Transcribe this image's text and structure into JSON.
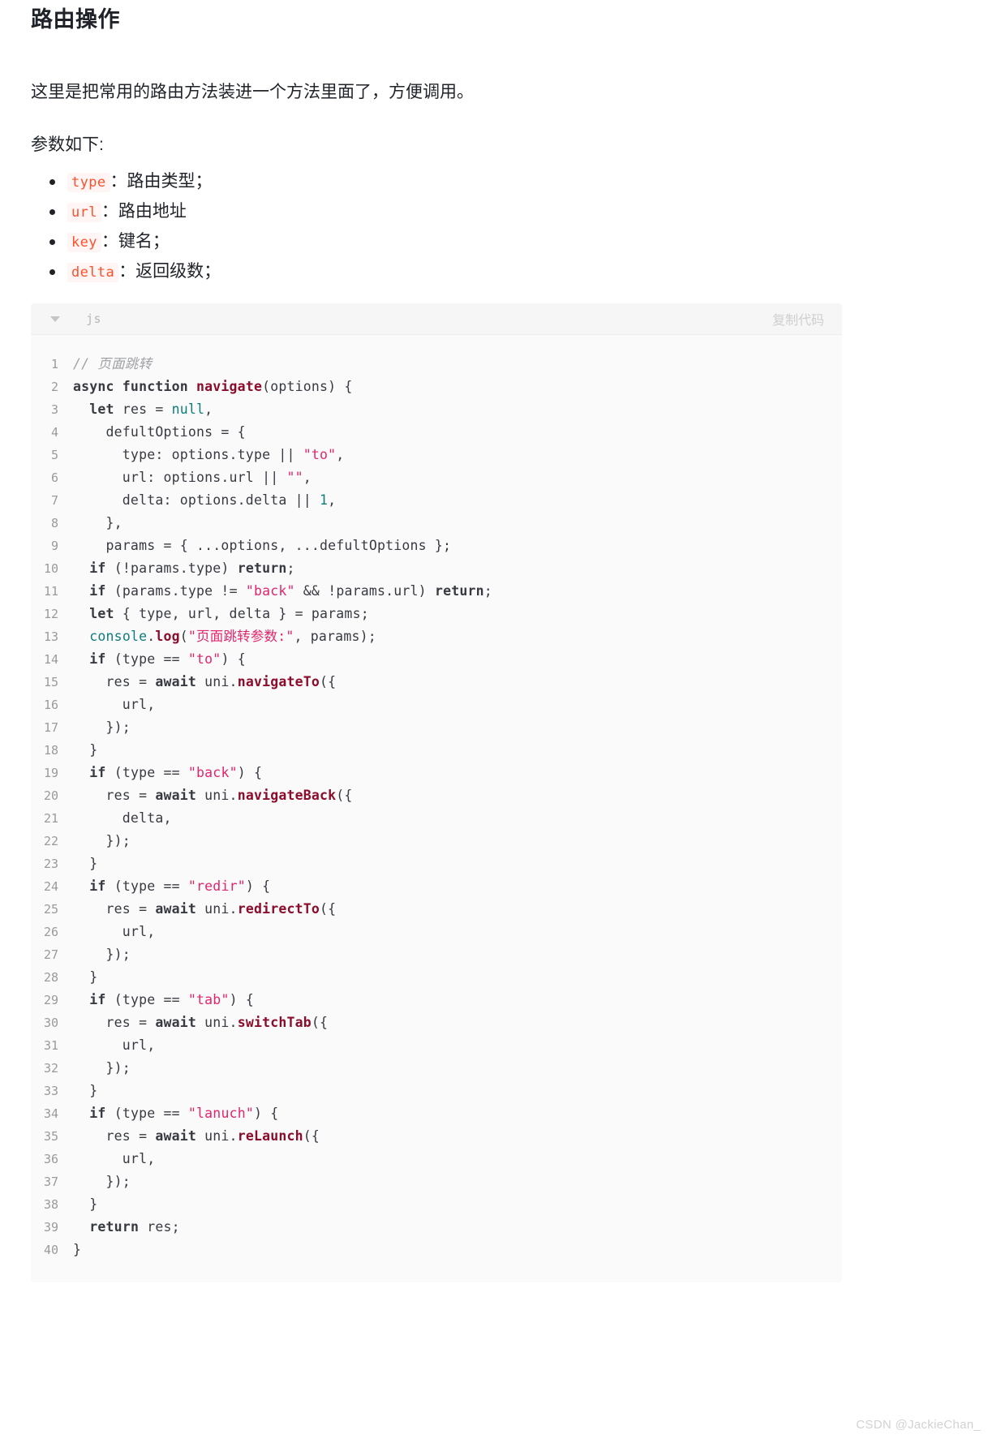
{
  "document": {
    "title": "路由操作",
    "intro": "这里是把常用的路由方法装进一个方法里面了，方便调用。",
    "params_label": "参数如下:"
  },
  "params": [
    {
      "code": "type",
      "desc": "：路由类型；"
    },
    {
      "code": "url",
      "desc": "：路由地址"
    },
    {
      "code": "key",
      "desc": "：键名；"
    },
    {
      "code": "delta",
      "desc": "：返回级数；"
    }
  ],
  "code_block": {
    "language": "js",
    "copy_label": "复制代码",
    "collapse_icon": "chevron-down-icon",
    "lines": [
      {
        "n": "1",
        "tokens": [
          {
            "t": "com",
            "v": "// 页面跳转"
          }
        ]
      },
      {
        "n": "2",
        "tokens": [
          {
            "t": "kw",
            "v": "async function "
          },
          {
            "t": "fn",
            "v": "navigate"
          },
          {
            "t": "pln",
            "v": "(options) {"
          }
        ]
      },
      {
        "n": "3",
        "tokens": [
          {
            "t": "pln",
            "v": "  "
          },
          {
            "t": "kw",
            "v": "let"
          },
          {
            "t": "pln",
            "v": " res = "
          },
          {
            "t": "blt",
            "v": "null"
          },
          {
            "t": "pln",
            "v": ","
          }
        ]
      },
      {
        "n": "4",
        "tokens": [
          {
            "t": "pln",
            "v": "    defultOptions = {"
          }
        ]
      },
      {
        "n": "5",
        "tokens": [
          {
            "t": "pln",
            "v": "      type: options.type || "
          },
          {
            "t": "str",
            "v": "\"to\""
          },
          {
            "t": "pln",
            "v": ","
          }
        ]
      },
      {
        "n": "6",
        "tokens": [
          {
            "t": "pln",
            "v": "      url: options.url || "
          },
          {
            "t": "str",
            "v": "\"\""
          },
          {
            "t": "pln",
            "v": ","
          }
        ]
      },
      {
        "n": "7",
        "tokens": [
          {
            "t": "pln",
            "v": "      delta: options.delta || "
          },
          {
            "t": "num",
            "v": "1"
          },
          {
            "t": "pln",
            "v": ","
          }
        ]
      },
      {
        "n": "8",
        "tokens": [
          {
            "t": "pln",
            "v": "    },"
          }
        ]
      },
      {
        "n": "9",
        "tokens": [
          {
            "t": "pln",
            "v": "    params = { ...options, ...defultOptions };"
          }
        ]
      },
      {
        "n": "10",
        "tokens": [
          {
            "t": "pln",
            "v": "  "
          },
          {
            "t": "kw",
            "v": "if"
          },
          {
            "t": "pln",
            "v": " (!params.type) "
          },
          {
            "t": "kw",
            "v": "return"
          },
          {
            "t": "pln",
            "v": ";"
          }
        ]
      },
      {
        "n": "11",
        "tokens": [
          {
            "t": "pln",
            "v": "  "
          },
          {
            "t": "kw",
            "v": "if"
          },
          {
            "t": "pln",
            "v": " (params.type != "
          },
          {
            "t": "str",
            "v": "\"back\""
          },
          {
            "t": "pln",
            "v": " && !params.url) "
          },
          {
            "t": "kw",
            "v": "return"
          },
          {
            "t": "pln",
            "v": ";"
          }
        ]
      },
      {
        "n": "12",
        "tokens": [
          {
            "t": "pln",
            "v": "  "
          },
          {
            "t": "kw",
            "v": "let"
          },
          {
            "t": "pln",
            "v": " { type, url, delta } = params;"
          }
        ]
      },
      {
        "n": "13",
        "tokens": [
          {
            "t": "pln",
            "v": "  "
          },
          {
            "t": "blt",
            "v": "console"
          },
          {
            "t": "pln",
            "v": "."
          },
          {
            "t": "fn",
            "v": "log"
          },
          {
            "t": "pln",
            "v": "("
          },
          {
            "t": "str",
            "v": "\"页面跳转参数:\""
          },
          {
            "t": "pln",
            "v": ", params);"
          }
        ]
      },
      {
        "n": "14",
        "tokens": [
          {
            "t": "pln",
            "v": "  "
          },
          {
            "t": "kw",
            "v": "if"
          },
          {
            "t": "pln",
            "v": " (type == "
          },
          {
            "t": "str",
            "v": "\"to\""
          },
          {
            "t": "pln",
            "v": ") {"
          }
        ]
      },
      {
        "n": "15",
        "tokens": [
          {
            "t": "pln",
            "v": "    res = "
          },
          {
            "t": "kw",
            "v": "await"
          },
          {
            "t": "pln",
            "v": " uni."
          },
          {
            "t": "fn",
            "v": "navigateTo"
          },
          {
            "t": "pln",
            "v": "({"
          }
        ]
      },
      {
        "n": "16",
        "tokens": [
          {
            "t": "pln",
            "v": "      url,"
          }
        ]
      },
      {
        "n": "17",
        "tokens": [
          {
            "t": "pln",
            "v": "    });"
          }
        ]
      },
      {
        "n": "18",
        "tokens": [
          {
            "t": "pln",
            "v": "  }"
          }
        ]
      },
      {
        "n": "19",
        "tokens": [
          {
            "t": "pln",
            "v": "  "
          },
          {
            "t": "kw",
            "v": "if"
          },
          {
            "t": "pln",
            "v": " (type == "
          },
          {
            "t": "str",
            "v": "\"back\""
          },
          {
            "t": "pln",
            "v": ") {"
          }
        ]
      },
      {
        "n": "20",
        "tokens": [
          {
            "t": "pln",
            "v": "    res = "
          },
          {
            "t": "kw",
            "v": "await"
          },
          {
            "t": "pln",
            "v": " uni."
          },
          {
            "t": "fn",
            "v": "navigateBack"
          },
          {
            "t": "pln",
            "v": "({"
          }
        ]
      },
      {
        "n": "21",
        "tokens": [
          {
            "t": "pln",
            "v": "      delta,"
          }
        ]
      },
      {
        "n": "22",
        "tokens": [
          {
            "t": "pln",
            "v": "    });"
          }
        ]
      },
      {
        "n": "23",
        "tokens": [
          {
            "t": "pln",
            "v": "  }"
          }
        ]
      },
      {
        "n": "24",
        "tokens": [
          {
            "t": "pln",
            "v": "  "
          },
          {
            "t": "kw",
            "v": "if"
          },
          {
            "t": "pln",
            "v": " (type == "
          },
          {
            "t": "str",
            "v": "\"redir\""
          },
          {
            "t": "pln",
            "v": ") {"
          }
        ]
      },
      {
        "n": "25",
        "tokens": [
          {
            "t": "pln",
            "v": "    res = "
          },
          {
            "t": "kw",
            "v": "await"
          },
          {
            "t": "pln",
            "v": " uni."
          },
          {
            "t": "fn",
            "v": "redirectTo"
          },
          {
            "t": "pln",
            "v": "({"
          }
        ]
      },
      {
        "n": "26",
        "tokens": [
          {
            "t": "pln",
            "v": "      url,"
          }
        ]
      },
      {
        "n": "27",
        "tokens": [
          {
            "t": "pln",
            "v": "    });"
          }
        ]
      },
      {
        "n": "28",
        "tokens": [
          {
            "t": "pln",
            "v": "  }"
          }
        ]
      },
      {
        "n": "29",
        "tokens": [
          {
            "t": "pln",
            "v": "  "
          },
          {
            "t": "kw",
            "v": "if"
          },
          {
            "t": "pln",
            "v": " (type == "
          },
          {
            "t": "str",
            "v": "\"tab\""
          },
          {
            "t": "pln",
            "v": ") {"
          }
        ]
      },
      {
        "n": "30",
        "tokens": [
          {
            "t": "pln",
            "v": "    res = "
          },
          {
            "t": "kw",
            "v": "await"
          },
          {
            "t": "pln",
            "v": " uni."
          },
          {
            "t": "fn",
            "v": "switchTab"
          },
          {
            "t": "pln",
            "v": "({"
          }
        ]
      },
      {
        "n": "31",
        "tokens": [
          {
            "t": "pln",
            "v": "      url,"
          }
        ]
      },
      {
        "n": "32",
        "tokens": [
          {
            "t": "pln",
            "v": "    });"
          }
        ]
      },
      {
        "n": "33",
        "tokens": [
          {
            "t": "pln",
            "v": "  }"
          }
        ]
      },
      {
        "n": "34",
        "tokens": [
          {
            "t": "pln",
            "v": "  "
          },
          {
            "t": "kw",
            "v": "if"
          },
          {
            "t": "pln",
            "v": " (type == "
          },
          {
            "t": "str",
            "v": "\"lanuch\""
          },
          {
            "t": "pln",
            "v": ") {"
          }
        ]
      },
      {
        "n": "35",
        "tokens": [
          {
            "t": "pln",
            "v": "    res = "
          },
          {
            "t": "kw",
            "v": "await"
          },
          {
            "t": "pln",
            "v": " uni."
          },
          {
            "t": "fn",
            "v": "reLaunch"
          },
          {
            "t": "pln",
            "v": "({"
          }
        ]
      },
      {
        "n": "36",
        "tokens": [
          {
            "t": "pln",
            "v": "      url,"
          }
        ]
      },
      {
        "n": "37",
        "tokens": [
          {
            "t": "pln",
            "v": "    });"
          }
        ]
      },
      {
        "n": "38",
        "tokens": [
          {
            "t": "pln",
            "v": "  }"
          }
        ]
      },
      {
        "n": "39",
        "tokens": [
          {
            "t": "pln",
            "v": "  "
          },
          {
            "t": "kw",
            "v": "return"
          },
          {
            "t": "pln",
            "v": " res;"
          }
        ]
      },
      {
        "n": "40",
        "tokens": [
          {
            "t": "pln",
            "v": "}"
          }
        ]
      }
    ]
  },
  "watermark": "CSDN @JackieChan_"
}
